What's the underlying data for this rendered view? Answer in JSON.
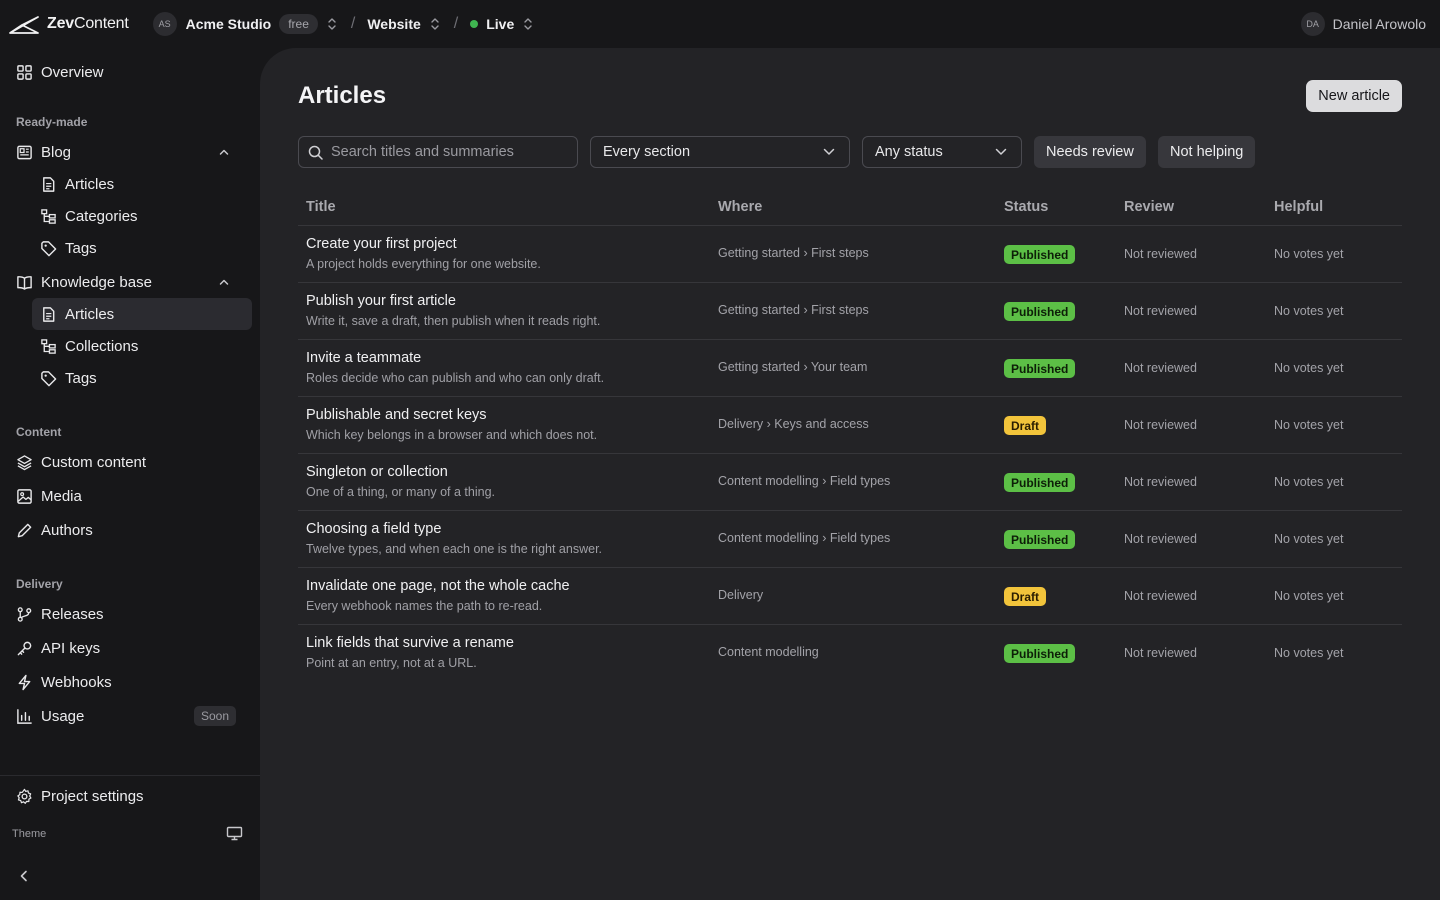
{
  "brand": {
    "name_bold": "Zev",
    "name_rest": "Content"
  },
  "workspace": {
    "initials": "AS",
    "name": "Acme Studio",
    "plan": "free"
  },
  "project": {
    "name": "Website"
  },
  "environment": {
    "name": "Live",
    "color": "#3fb550"
  },
  "user": {
    "initials": "DA",
    "name": "Daniel Arowolo"
  },
  "sidebar": {
    "overview": "Overview",
    "ready_made_label": "Ready-made",
    "blog": {
      "label": "Blog",
      "items": [
        "Articles",
        "Categories",
        "Tags"
      ]
    },
    "knowledge_base": {
      "label": "Knowledge base",
      "items": [
        "Articles",
        "Collections",
        "Tags"
      ]
    },
    "content_label": "Content",
    "content_items": [
      "Custom content",
      "Media",
      "Authors"
    ],
    "delivery_label": "Delivery",
    "delivery_items": [
      "Releases",
      "API keys",
      "Webhooks",
      "Usage"
    ],
    "usage_badge": "Soon",
    "project_settings": "Project settings",
    "theme_label": "Theme"
  },
  "page": {
    "title": "Articles",
    "new_button": "New article",
    "search_placeholder": "Search titles and summaries",
    "section_filter": "Every section",
    "status_filter": "Any status",
    "chip_needs_review": "Needs review",
    "chip_not_helping": "Not helping"
  },
  "table": {
    "headers": {
      "title": "Title",
      "where": "Where",
      "status": "Status",
      "review": "Review",
      "helpful": "Helpful"
    },
    "rows": [
      {
        "title": "Create your first project",
        "summary": "A project holds everything for one website.",
        "where": "Getting started › First steps",
        "status": "Published",
        "review": "Not reviewed",
        "helpful": "No votes yet"
      },
      {
        "title": "Publish your first article",
        "summary": "Write it, save a draft, then publish when it reads right.",
        "where": "Getting started › First steps",
        "status": "Published",
        "review": "Not reviewed",
        "helpful": "No votes yet"
      },
      {
        "title": "Invite a teammate",
        "summary": "Roles decide who can publish and who can only draft.",
        "where": "Getting started › Your team",
        "status": "Published",
        "review": "Not reviewed",
        "helpful": "No votes yet"
      },
      {
        "title": "Publishable and secret keys",
        "summary": "Which key belongs in a browser and which does not.",
        "where": "Delivery › Keys and access",
        "status": "Draft",
        "review": "Not reviewed",
        "helpful": "No votes yet"
      },
      {
        "title": "Singleton or collection",
        "summary": "One of a thing, or many of a thing.",
        "where": "Content modelling › Field types",
        "status": "Published",
        "review": "Not reviewed",
        "helpful": "No votes yet"
      },
      {
        "title": "Choosing a field type",
        "summary": "Twelve types, and when each one is the right answer.",
        "where": "Content modelling › Field types",
        "status": "Published",
        "review": "Not reviewed",
        "helpful": "No votes yet"
      },
      {
        "title": "Invalidate one page, not the whole cache",
        "summary": "Every webhook names the path to re-read.",
        "where": "Delivery",
        "status": "Draft",
        "review": "Not reviewed",
        "helpful": "No votes yet"
      },
      {
        "title": "Link fields that survive a rename",
        "summary": "Point at an entry, not at a URL.",
        "where": "Content modelling",
        "status": "Published",
        "review": "Not reviewed",
        "helpful": "No votes yet"
      }
    ]
  },
  "colors": {
    "published": "#5cbf46",
    "draft": "#f2c43b",
    "accent_button": "#dcdcde"
  }
}
